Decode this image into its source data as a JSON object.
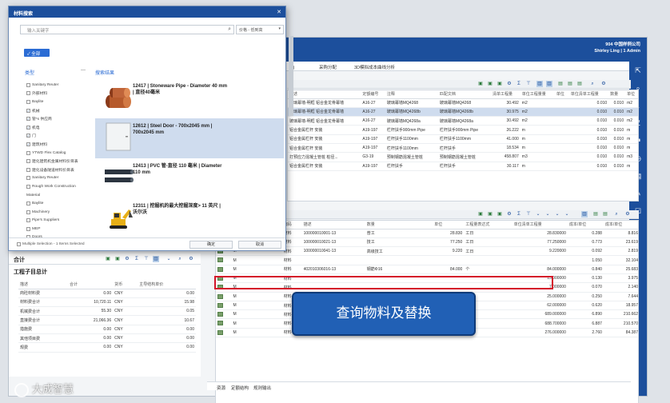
{
  "app": {
    "user_line1": "904 中国样例公司",
    "user_line2": "Shirley Ling | 1 Admin",
    "tabs": [
      "化)",
      "采购分配",
      "3D模拟成本曲线分析"
    ],
    "bottom_tabs": [
      "资源",
      "定额结构",
      "规则输出"
    ]
  },
  "colors": {
    "brand": "#1c4f9c",
    "highlight": "#d4142a",
    "banner": "#2160b5"
  },
  "top_grid": {
    "headers": [
      "描述",
      "定额编号",
      "注释",
      "匹配文档",
      "清单工程量",
      "单位工程量量",
      "单位",
      "单位清单工程量",
      "数量",
      "单位"
    ],
    "rows": [
      [
        "玻璃幕墙-明框 铝合金龙骨幕墙",
        "A16-27",
        "玻璃幕墙MQ4268",
        "玻璃幕墙MQ4268",
        "30.492",
        "m2",
        "",
        "0.010",
        "0.010",
        "m2"
      ],
      [
        "玻璃幕墙-明框 铝合金龙骨幕墙",
        "A16-27",
        "玻璃幕墙MQ4268b",
        "玻璃幕墙MQ4268b",
        "30.975",
        "m2",
        "",
        "0.010",
        "0.010",
        "m2"
      ],
      [
        "玻璃幕墙-明框 铝合金龙骨幕墙",
        "A16-27",
        "玻璃幕墙MQ4268a",
        "玻璃幕墙MQ4268a",
        "30.492",
        "m2",
        "",
        "0.010",
        "0.010",
        "m2"
      ],
      [
        "铝合金属栏杆 安装",
        "A19-197",
        "栏杆扶手900mm Pipe",
        "栏杆扶手900mm Pipe",
        "26.222",
        "m",
        "",
        "0.010",
        "0.010",
        "m"
      ],
      [
        "铝合金属栏杆 安装",
        "A19-197",
        "栏杆扶手1100mm",
        "栏杆扶手1100mm",
        "41.000",
        "m",
        "",
        "0.010",
        "0.010",
        "m"
      ],
      [
        "铝合金属栏杆 安装",
        "A19-197",
        "栏杆扶手1100mm",
        "栏杆扶手",
        "18.534",
        "m",
        "",
        "0.010",
        "0.010",
        "m"
      ],
      [
        "打预应力混凝土管桩 桩径...",
        "G3-19",
        "预制钢筋混凝土管桩",
        "预制钢筋混凝土管桩",
        "458.807",
        "m3",
        "",
        "0.010",
        "0.010",
        "m3"
      ],
      [
        "铝合金属栏杆 安装",
        "A19-197",
        "栏杆扶手",
        "栏杆扶手",
        "30.117",
        "m",
        "",
        "0.010",
        "0.010",
        "m"
      ]
    ]
  },
  "bottom_grid": {
    "headers": [
      "",
      "资源-资源类型",
      "编码",
      "描述",
      "数量",
      "单位",
      "工程量表达式",
      "单位清单工程量",
      "成本/单位",
      "成本/单位"
    ],
    "rows": [
      [
        "",
        "M",
        "材料",
        "100000010001-13",
        "普工",
        "28.830",
        "工日",
        "28.830000",
        "0.288",
        "8.816"
      ],
      [
        "",
        "M",
        "材料",
        "100000010021-13",
        "技工",
        "77.250",
        "工日",
        "77.250000",
        "0.773",
        "23.619"
      ],
      [
        "",
        "M",
        "材料",
        "100000010041-13",
        "高级技工",
        "9.220",
        "工日",
        "9.220000",
        "0.092",
        "2.819"
      ],
      [
        "",
        "M",
        "材料",
        "",
        "",
        "",
        "",
        "",
        "1.050",
        "32.104"
      ],
      [
        "",
        "M",
        "材料",
        "402010306016-13",
        "钢筋Φ16",
        "84.000",
        "个",
        "84.000000",
        "0.840",
        "25.683"
      ],
      [
        "",
        "M",
        "材料",
        "",
        "",
        "",
        "",
        "13.000000",
        "0.130",
        "3.975"
      ],
      [
        "",
        "M",
        "材料",
        "",
        "",
        "",
        "",
        "7.000000",
        "0.070",
        "2.140"
      ],
      [
        "",
        "M",
        "材料",
        "",
        "",
        "",
        "",
        "25.000000",
        "0.250",
        "7.644"
      ],
      [
        "",
        "M",
        "材料",
        "",
        "",
        "",
        "",
        "62.000000",
        "0.620",
        "18.957"
      ],
      [
        "",
        "M",
        "材料",
        "402303070009-13",
        "混凝土",
        "689.000",
        "m",
        "689.000000",
        "6.890",
        "210.662"
      ],
      [
        "",
        "M",
        "材料",
        "402303070011-13",
        "幕墙专用双面胶条",
        "688.700",
        "m",
        "688.700000",
        "6.887",
        "210.570"
      ],
      [
        "",
        "M",
        "材料",
        "402507040006-13",
        "聚烷胶2-2.100ml/卷",
        "276.000",
        "卷",
        "276.000000",
        "2.760",
        "84.387"
      ]
    ]
  },
  "summary": {
    "title": "合计",
    "subtitle": "工程子目总计",
    "headers": [
      "描述",
      "合计",
      "货币",
      "主导结构单价"
    ],
    "rows": [
      [
        "商砼材料费",
        "0.00",
        "CNY",
        "0.00"
      ],
      [
        "材料费合计",
        "10,720.11",
        "CNY",
        "15.98"
      ],
      [
        "机械费合计",
        "55.30",
        "CNY",
        "0.05"
      ],
      [
        "直接费合计",
        "21,066.36",
        "CNY",
        "10.67"
      ],
      [
        "措施费",
        "0.00",
        "CNY",
        "0.00"
      ],
      [
        "其他项目费",
        "0.00",
        "CNY",
        "0.00"
      ],
      [
        "规费",
        "0.00",
        "CNY",
        "0.00"
      ]
    ]
  },
  "dialog": {
    "title": "材料搜索",
    "search_placeholder": "输入关键字",
    "sort_label": "价格 - 低到高",
    "all_button": "全部",
    "categories_title": "类型",
    "results_title": "搜索结果",
    "collapse_label": "—",
    "categories": [
      {
        "label": "Sanitary Reuter",
        "checked": false
      },
      {
        "label": "外部材料",
        "checked": false
      },
      {
        "label": "Baylite",
        "checked": false
      },
      {
        "label": "机械",
        "checked": true
      },
      {
        "label": "管*s 供应商",
        "checked": true
      },
      {
        "label": "机电",
        "checked": true
      },
      {
        "label": "门",
        "checked": true
      },
      {
        "label": "建筑材料",
        "checked": true
      },
      {
        "label": "YTWD Flex Catalog",
        "checked": false
      },
      {
        "label": "建化建筑机金属材料价目表",
        "checked": false
      },
      {
        "label": "建化设备隧道材料价目表",
        "checked": false
      },
      {
        "label": "Sanitary Reuter",
        "checked": false
      },
      {
        "label": "Rough Work Construction",
        "checked": false
      },
      {
        "label": "Material",
        "checked": null
      },
      {
        "label": "Baylite",
        "checked": false
      },
      {
        "label": "Machinery",
        "checked": false
      },
      {
        "label": "Pipe's Suppliers",
        "checked": false
      },
      {
        "label": "MEP",
        "checked": false
      },
      {
        "label": "Doors",
        "checked": false
      }
    ],
    "results": [
      {
        "line1": "12417 | Stoneware Pipe - Diameter 40 mm",
        "line2": "| 直径40毫米"
      },
      {
        "line1": "12612 | Steel Door - 700x2045 mm |",
        "line2": "700x2045 mm"
      },
      {
        "line1": "12413 | PVC 管-直径 110 毫米 | Diameter",
        "line2": "110 mm"
      },
      {
        "line1": "12311 | 挖掘机的最大挖掘深度> 11 英尺 |",
        "line2": "沃尔沃"
      }
    ],
    "footer_text": "Multiple Selection - 1 Items Selected",
    "ok_label": "确定",
    "cancel_label": "取消"
  },
  "banner_text": "查询物料及替换",
  "watermark_text": "大成智慧"
}
